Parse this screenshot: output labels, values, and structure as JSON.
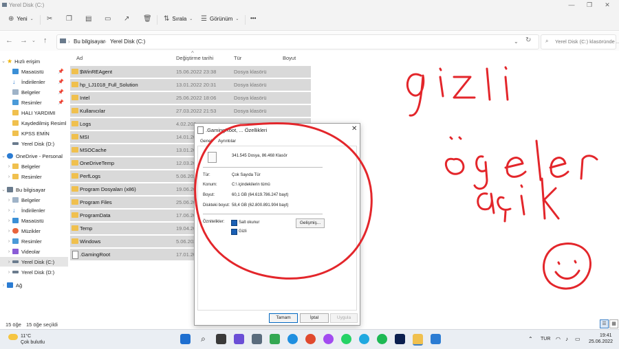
{
  "window": {
    "title": "Yerel Disk (C:)"
  },
  "toolbar": {
    "new_label": "Yeni",
    "sort_label": "Sırala",
    "view_label": "Görünüm",
    "more_label": "•••"
  },
  "address": {
    "crumbs": [
      "Bu bilgisayar",
      "Yerel Disk (C:)"
    ],
    "search_placeholder": "Yerel Disk (C:) klasöründe ..."
  },
  "sidebar": {
    "items": [
      {
        "label": "Hızlı erişim"
      },
      {
        "label": "Masaüstü"
      },
      {
        "label": "İndirilenler"
      },
      {
        "label": "Belgeler"
      },
      {
        "label": "Resimler"
      },
      {
        "label": "HALI YARDIMI"
      },
      {
        "label": "Kaydedilmiş Resiml"
      },
      {
        "label": "KPSS EMİN"
      },
      {
        "label": "Yerel Disk (D:)"
      },
      {
        "label": "OneDrive - Personal"
      },
      {
        "label": "Belgeler"
      },
      {
        "label": "Resimler"
      },
      {
        "label": "Bu bilgisayar"
      },
      {
        "label": "Belgeler"
      },
      {
        "label": "İndirilenler"
      },
      {
        "label": "Masaüstü"
      },
      {
        "label": "Müzikler"
      },
      {
        "label": "Resimler"
      },
      {
        "label": "Videolar"
      },
      {
        "label": "Yerel Disk (C:)"
      },
      {
        "label": "Yerel Disk (D:)"
      },
      {
        "label": "Ağ"
      }
    ]
  },
  "columns": {
    "name": "Ad",
    "date": "Değiştirme tarihi",
    "type": "Tür",
    "size": "Boyut"
  },
  "files": [
    {
      "name": "$WinREAgent",
      "date": "15.06.2022 23:38",
      "type": "Dosya klasörü"
    },
    {
      "name": "hp_LJ1018_Full_Solution",
      "date": "13.01.2022 20:31",
      "type": "Dosya klasörü"
    },
    {
      "name": "Intel",
      "date": "25.06.2022 18:06",
      "type": "Dosya klasörü"
    },
    {
      "name": "Kullanıcılar",
      "date": "27.03.2022 21:53",
      "type": "Dosya klasörü"
    },
    {
      "name": "Logs",
      "date": "4.02.202",
      "type": ""
    },
    {
      "name": "MSI",
      "date": "14.01.20",
      "type": ""
    },
    {
      "name": "MSOCache",
      "date": "13.01.20",
      "type": ""
    },
    {
      "name": "OneDriveTemp",
      "date": "12.03.20",
      "type": ""
    },
    {
      "name": "PerfLogs",
      "date": "5.06.202",
      "type": ""
    },
    {
      "name": "Program Dosyaları (x86)",
      "date": "19.06.20",
      "type": ""
    },
    {
      "name": "Program Files",
      "date": "25.06.20",
      "type": ""
    },
    {
      "name": "ProgramData",
      "date": "17.06.20",
      "type": ""
    },
    {
      "name": "Temp",
      "date": "19.04.20",
      "type": ""
    },
    {
      "name": "Windows",
      "date": "5.06.202",
      "type": ""
    },
    {
      "name": ".GamingRoot",
      "date": "17.01.20",
      "type": ""
    }
  ],
  "status": {
    "count": "15 öğe",
    "selected": "15 öğe seçildi"
  },
  "dialog": {
    "title": ".GamingRoot, ... Özellikleri",
    "tabs": [
      "Genel",
      "Ayrıntılar"
    ],
    "summary": "341.545 Dosya, 86.468 Klasör",
    "type_label": "Tür:",
    "type_value": "Çok Sayıda Tür",
    "location_label": "Konum:",
    "location_value": "C:\\ içindekilerin tümü",
    "size_label": "Boyut:",
    "size_value": "60,1 GB (64.619.786.247 bayt)",
    "disk_size_label": "Diskteki boyut:",
    "disk_size_value": "58,4 GB (62.800.891.904 bayt)",
    "attributes_label": "Öznitelikler:",
    "readonly_label": "Salt okunur",
    "hidden_label": "Gizli",
    "advanced_button": "Gelişmiş...",
    "ok_button": "Tamam",
    "cancel_button": "İptal",
    "apply_button": "Uygula"
  },
  "taskbar": {
    "weather_temp": "11°C",
    "weather_desc": "Çok bulutlu",
    "language": "TUR",
    "time": "19:41",
    "date": "25.06.2022"
  },
  "colors": {
    "red_ink": "#e3262b",
    "folder": "#f0c04e",
    "accent": "#0067c0"
  },
  "annotation": {
    "text": "gizli öğeler açık",
    "has_smiley": true
  }
}
